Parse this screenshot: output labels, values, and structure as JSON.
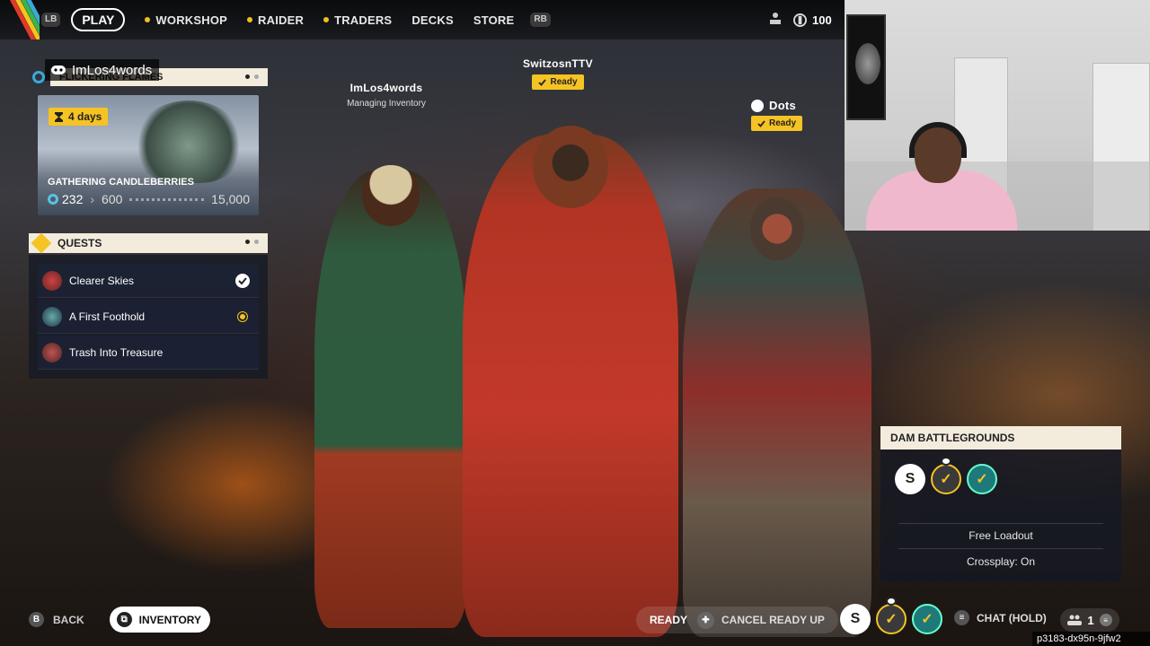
{
  "nav": {
    "left_bumper": "LB",
    "right_bumper": "RB",
    "items": [
      {
        "label": "PLAY"
      },
      {
        "label": "WORKSHOP"
      },
      {
        "label": "RAIDER"
      },
      {
        "label": "TRADERS"
      },
      {
        "label": "DECKS"
      },
      {
        "label": "STORE"
      }
    ],
    "currency_value": "100"
  },
  "discord_user": "ImLos4words",
  "event": {
    "header": "FLICKERING FLAMES",
    "days_left": "4 days",
    "title": "GATHERING CANDLEBERRIES",
    "current": "232",
    "next_milestone": "600",
    "goal": "15,000"
  },
  "quests": {
    "header": "QUESTS",
    "items": [
      {
        "label": "Clearer Skies",
        "status": "complete"
      },
      {
        "label": "A First Foothold",
        "status": "active"
      },
      {
        "label": "Trash Into Treasure",
        "status": "none"
      }
    ]
  },
  "players": {
    "p1": {
      "name": "ImLos4words",
      "status": "Managing Inventory"
    },
    "p2": {
      "name": "SwitzosnTTV",
      "ready": "Ready"
    },
    "p3": {
      "name": "Dots",
      "ready": "Ready"
    }
  },
  "map": {
    "name": "DAM BATTLEGROUNDS",
    "loadout": "Free Loadout",
    "crossplay": "Crossplay: On"
  },
  "bottom": {
    "back_key": "B",
    "back": "BACK",
    "inventory": "INVENTORY",
    "ready": "READY",
    "cancel_ready": "CANCEL READY UP",
    "chat": "CHAT (HOLD)",
    "party_count": "1"
  },
  "session_code": "p3183-dx95n-9jfw2",
  "colors": {
    "accent_yellow": "#f5c323",
    "panel_cream": "#f3ecdd",
    "panel_dark": "#141824"
  }
}
